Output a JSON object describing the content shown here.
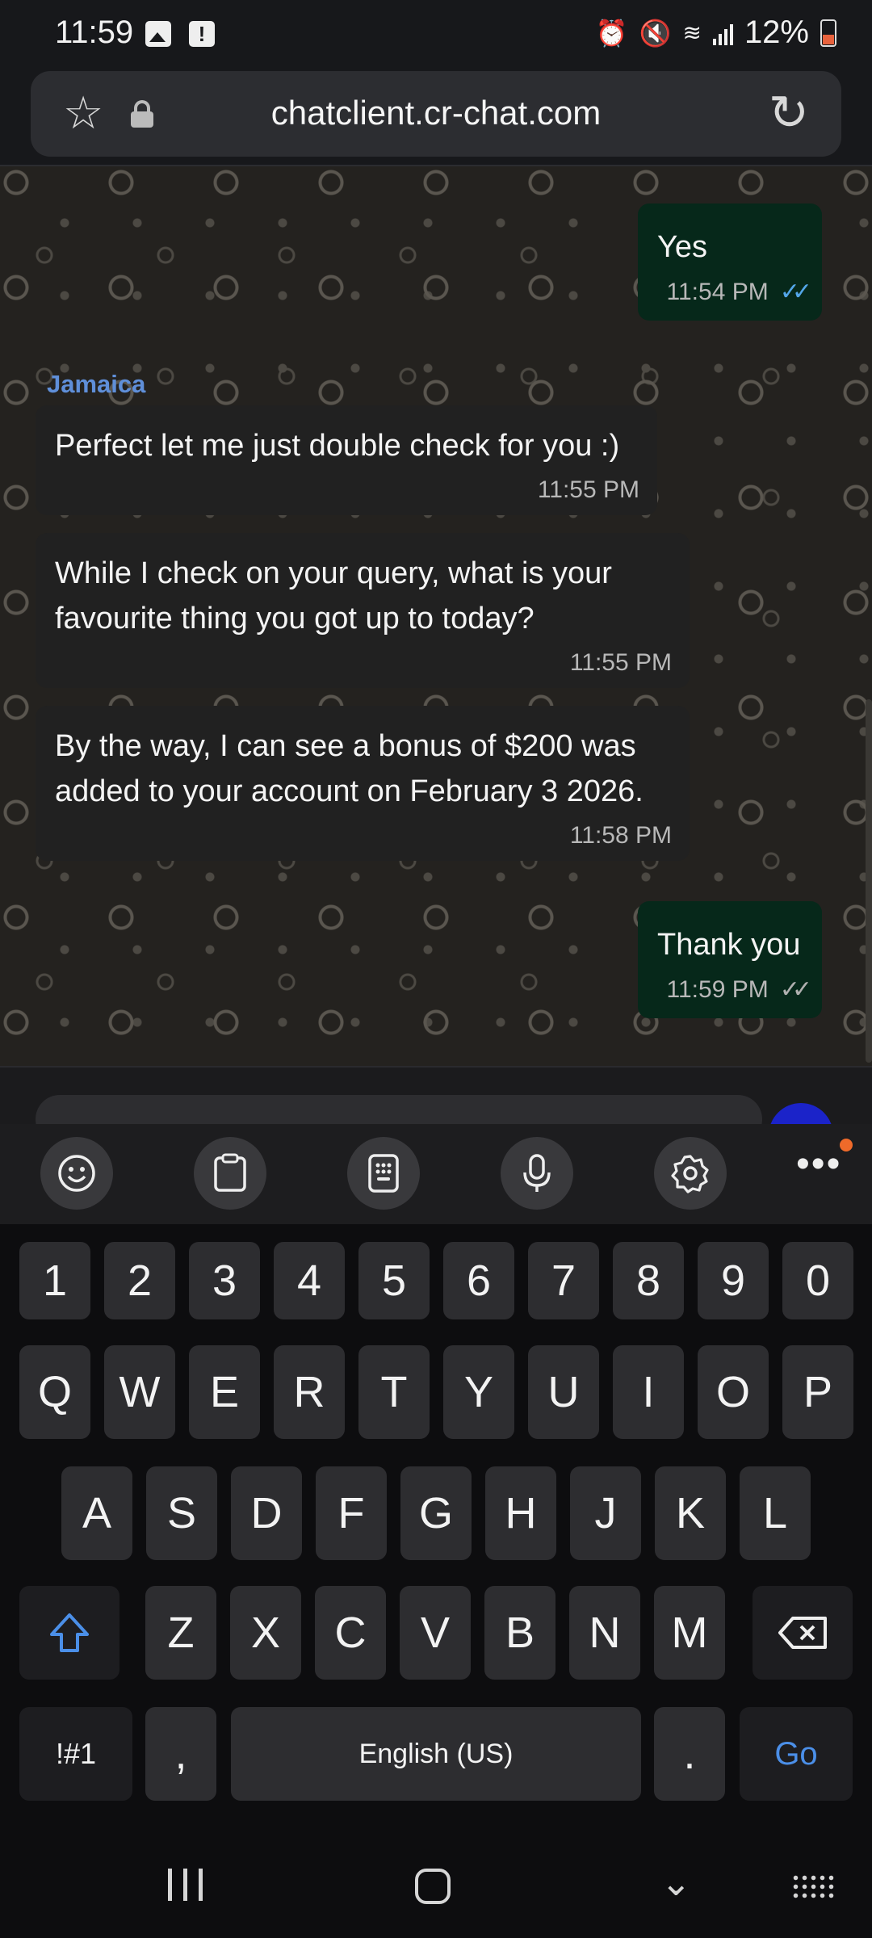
{
  "status_bar": {
    "time": "11:59",
    "battery_text": "12%",
    "battery_color": "#e8623d",
    "icons": [
      "image-icon",
      "alert-icon",
      "alarm-icon",
      "mute-icon",
      "wifi-icon",
      "signal-icon",
      "battery-icon"
    ]
  },
  "browser": {
    "url": "chatclient.cr-chat.com"
  },
  "chat": {
    "messages": [
      {
        "direction": "outgoing",
        "text": "Yes",
        "time": "11:54 PM",
        "status": "read"
      },
      {
        "direction": "incoming",
        "sender": "Jamaica",
        "text": "Perfect let me just double check for you :)",
        "time": "11:55 PM"
      },
      {
        "direction": "incoming",
        "text": "While I check on your query, what is your\nfavourite thing you got up to today?",
        "time": "11:55 PM"
      },
      {
        "direction": "incoming",
        "text": "By the way, I can see a bonus of $200 was\nadded to your account on February 3 2026.",
        "time": "11:58 PM"
      },
      {
        "direction": "outgoing",
        "text": "Thank you",
        "time": "11:59 PM",
        "status": "sent"
      }
    ],
    "colors": {
      "outgoing_bubble": "#06281a",
      "incoming_bubble": "#212121",
      "sender_name": "#5f8fd9",
      "read_tick": "#53a6e8"
    }
  },
  "keyboard": {
    "toolbar": [
      "emoji-icon",
      "clipboard-icon",
      "keypad-icon",
      "mic-icon",
      "settings-icon",
      "more-icon"
    ],
    "number_row": [
      "1",
      "2",
      "3",
      "4",
      "5",
      "6",
      "7",
      "8",
      "9",
      "0"
    ],
    "row1": [
      "Q",
      "W",
      "E",
      "R",
      "T",
      "Y",
      "U",
      "I",
      "O",
      "P"
    ],
    "row2": [
      "A",
      "S",
      "D",
      "F",
      "G",
      "H",
      "J",
      "K",
      "L"
    ],
    "row3": [
      "Z",
      "X",
      "C",
      "V",
      "B",
      "N",
      "M"
    ],
    "symbols_key": "!#1",
    "comma_key": ",",
    "space_key": "English (US)",
    "period_key": ".",
    "go_key": "Go",
    "accent": "#4b8fe8"
  }
}
